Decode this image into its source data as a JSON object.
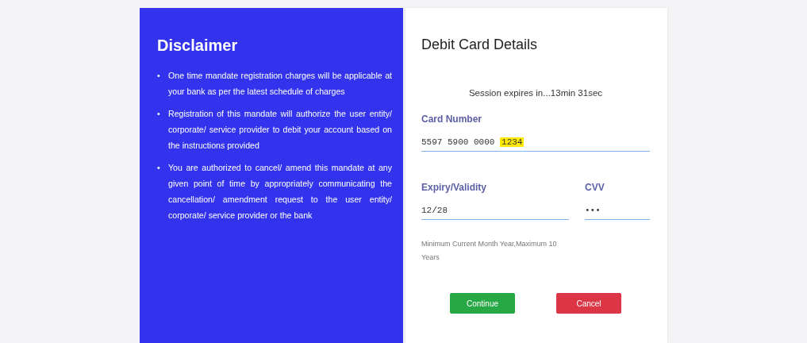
{
  "disclaimer": {
    "title": "Disclaimer",
    "marker": "•",
    "points": [
      "One time mandate registration charges will be applicable at your bank as per the latest schedule of charges",
      "Registration of this mandate will authorize the user entity/ corporate/ service provider to debit your account based on the instructions provided",
      "You are authorized to cancel/ amend this mandate at any given point of time by appropriately communicating the cancellation/ amendment request to the user entity/ corporate/ service provider or the bank"
    ]
  },
  "card_form": {
    "title": "Debit Card Details",
    "session": "Session expires in...13min 31sec",
    "card_number": {
      "label": "Card Number",
      "value": "5597 5900 0000",
      "highlighted": "1234"
    },
    "expiry": {
      "label": "Expiry/Validity",
      "value": "12/28"
    },
    "cvv": {
      "label": "CVV",
      "value": "•••"
    },
    "hint": "Minimum Current Month Year,Maximum 10 Years",
    "buttons": [
      {
        "label": "Continue",
        "kind": "primary"
      },
      {
        "label": "Cancel",
        "kind": "danger"
      }
    ]
  }
}
